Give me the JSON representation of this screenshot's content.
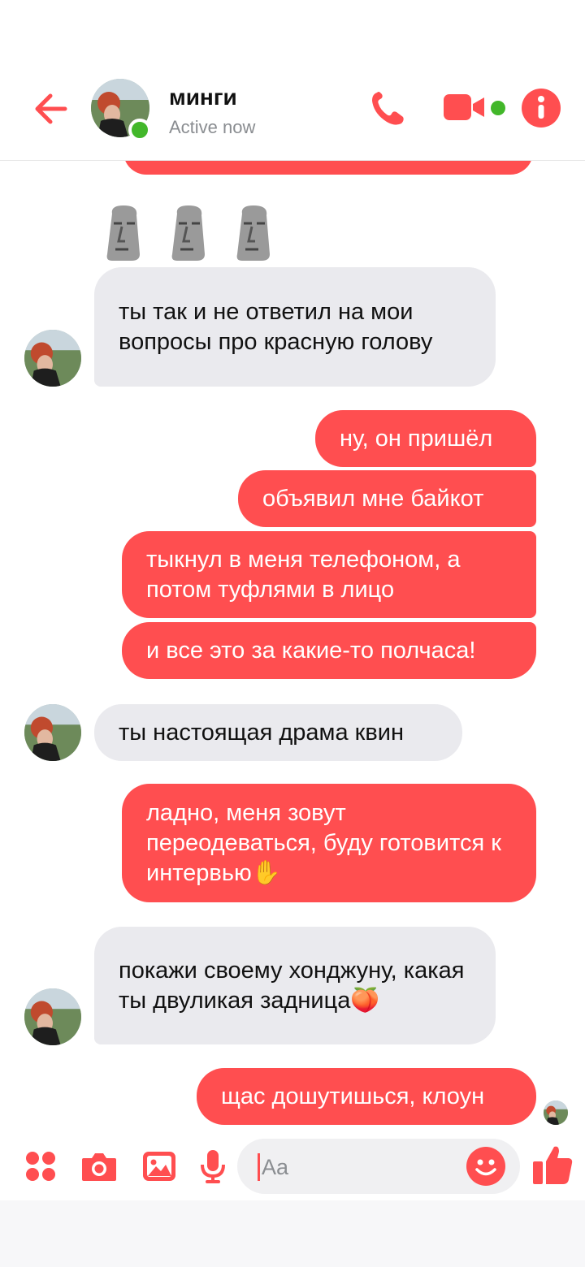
{
  "colors": {
    "accent": "#ff4e50",
    "incoming": "#eaeaee",
    "presence": "#42b72a"
  },
  "header": {
    "contact_name": "минги",
    "status": "Active now",
    "icons": [
      "back-arrow-icon",
      "phone-icon",
      "video-camera-icon",
      "info-icon"
    ]
  },
  "messages": [
    {
      "from": "them",
      "text": "🗿 🗿 🗿"
    },
    {
      "from": "them",
      "text": "ты так и не ответил на мои вопросы про красную голову"
    },
    {
      "from": "me",
      "text": "ну, он пришёл"
    },
    {
      "from": "me",
      "text": "объявил мне байкот"
    },
    {
      "from": "me",
      "text": "тыкнул в меня телефоном, а потом туфлями в лицо"
    },
    {
      "from": "me",
      "text": "и все это за какие-то полчаса!"
    },
    {
      "from": "them",
      "text": "ты настоящая драма квин"
    },
    {
      "from": "me",
      "text": "ладно, меня зовут переодеваться, буду готовится к интервью✋"
    },
    {
      "from": "them",
      "text": "покажи своему хонджуну, какая ты двуликая задница🍑"
    },
    {
      "from": "me",
      "text": "щас дошутишься, клоун"
    }
  ],
  "composer": {
    "placeholder": "Aa",
    "icons": [
      "apps-icon",
      "camera-icon",
      "gallery-icon",
      "microphone-icon",
      "emoji-icon",
      "thumbs-up-icon"
    ]
  }
}
